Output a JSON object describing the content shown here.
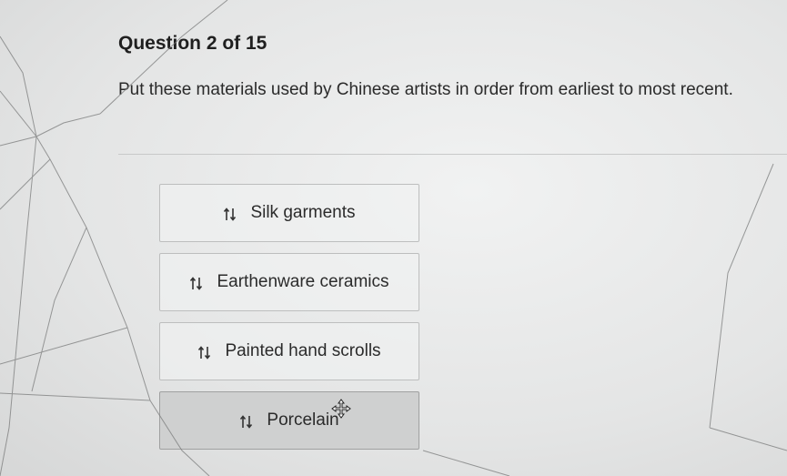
{
  "question": {
    "header": "Question 2 of 15",
    "prompt": "Put these materials used by Chinese artists in order from earliest to most recent."
  },
  "answers": [
    {
      "label": "Silk garments",
      "icon": "reorder-arrows-icon"
    },
    {
      "label": "Earthenware ceramics",
      "icon": "reorder-arrows-icon"
    },
    {
      "label": "Painted hand scrolls",
      "icon": "reorder-arrows-icon"
    },
    {
      "label": "Porcelain",
      "icon": "reorder-arrows-icon"
    }
  ],
  "cursor": {
    "icon": "move-cursor-icon"
  },
  "colors": {
    "background": "#e6e7e7",
    "card_border": "#bdbebe",
    "card_dragging": "#cfd0d0",
    "text": "#2b2b2b"
  }
}
